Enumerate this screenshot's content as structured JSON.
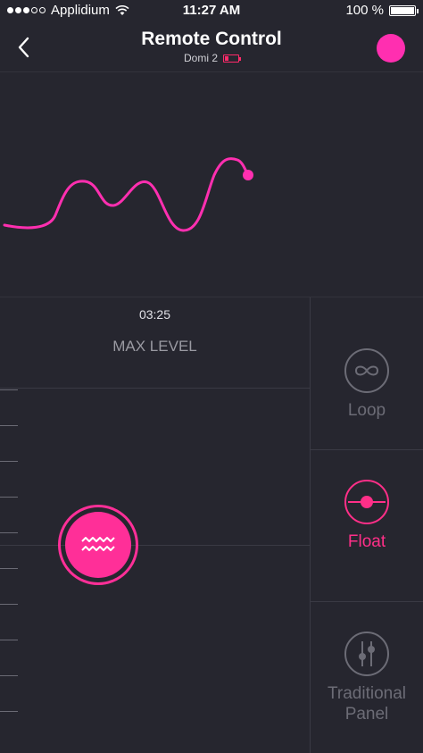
{
  "status_bar": {
    "carrier": "Applidium",
    "time": "11:27 AM",
    "battery": "100 %",
    "signal_dots_on": 3,
    "signal_dots_total": 5
  },
  "nav": {
    "title": "Remote Control",
    "device": "Domi 2",
    "back_icon": "chevron-left-icon",
    "accent_dot_color": "#ff2fb0",
    "battery_color": "#ff2a6a"
  },
  "wave": {
    "color": "#ff2fb0"
  },
  "control": {
    "time": "03:25",
    "level_label": "MAX LEVEL",
    "knob_icon": "wave-icon",
    "accent": "#ff2f98"
  },
  "modes": [
    {
      "label": "Loop",
      "icon": "infinity-icon",
      "active": false
    },
    {
      "label": "Float",
      "icon": "float-icon",
      "active": true
    },
    {
      "label": "Traditional\nPanel",
      "icon": "sliders-icon",
      "active": false
    }
  ]
}
